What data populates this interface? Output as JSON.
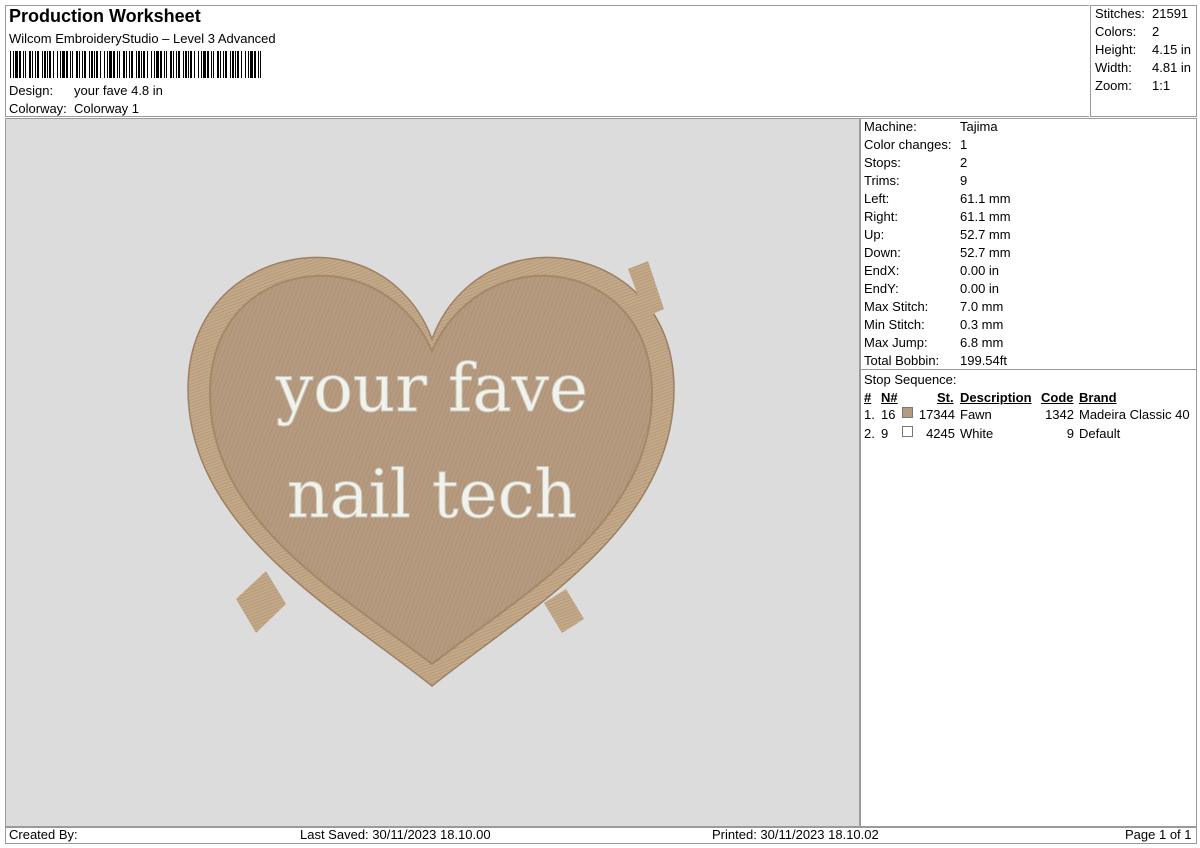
{
  "header": {
    "title": "Production Worksheet",
    "subtitle": "Wilcom EmbroideryStudio – Level 3 Advanced",
    "design_label": "Design:",
    "design_value": "your fave 4.8 in",
    "colorway_label": "Colorway:",
    "colorway_value": "Colorway 1"
  },
  "stats": [
    {
      "label": "Stitches:",
      "value": "21591"
    },
    {
      "label": "Colors:",
      "value": "2"
    },
    {
      "label": "Height:",
      "value": "4.15 in"
    },
    {
      "label": "Width:",
      "value": "4.81 in"
    },
    {
      "label": "Zoom:",
      "value": "1:1"
    }
  ],
  "machine_info": [
    {
      "label": "Machine:",
      "value": "Tajima"
    },
    {
      "label": "Color changes:",
      "value": "1"
    },
    {
      "label": "Stops:",
      "value": "2"
    },
    {
      "label": "Trims:",
      "value": "9"
    },
    {
      "label": "Left:",
      "value": "61.1 mm"
    },
    {
      "label": "Right:",
      "value": "61.1 mm"
    },
    {
      "label": "Up:",
      "value": "52.7 mm"
    },
    {
      "label": "Down:",
      "value": "52.7 mm"
    },
    {
      "label": "EndX:",
      "value": "0.00 in"
    },
    {
      "label": "EndY:",
      "value": "0.00 in"
    },
    {
      "label": "Max Stitch:",
      "value": "7.0 mm"
    },
    {
      "label": "Min Stitch:",
      "value": "0.3 mm"
    },
    {
      "label": "Max Jump:",
      "value": "6.8 mm"
    },
    {
      "label": "Total Bobbin:",
      "value": "199.54ft"
    }
  ],
  "stop_sequence": {
    "title": "Stop Sequence:",
    "headers": {
      "num": "#",
      "n": "N#",
      "st": "St.",
      "description": "Description",
      "code": "Code",
      "brand": "Brand"
    },
    "rows": [
      {
        "num": "1.",
        "n": "16",
        "color": "#b59a7f",
        "st": "17344",
        "description": "Fawn",
        "code": "1342",
        "brand": "Madeira Classic 40"
      },
      {
        "num": "2.",
        "n": "9",
        "color": "#ffffff",
        "st": "4245",
        "description": "White",
        "code": "9",
        "brand": "Default"
      }
    ]
  },
  "design": {
    "line1": "your fave",
    "line2": "nail tech",
    "fill_color": "#b59a7f",
    "text_color": "#f1f2ec"
  },
  "footer": {
    "created_by": "Created By:",
    "last_saved": "Last Saved: 30/11/2023 18.10.00",
    "printed": "Printed: 30/11/2023 18.10.02",
    "page": "Page 1 of 1"
  }
}
